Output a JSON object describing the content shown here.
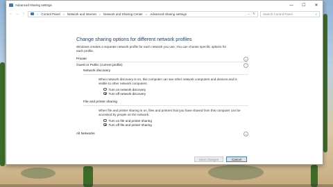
{
  "window": {
    "title": "Advanced sharing settings",
    "controls": {
      "minimize": "—",
      "maximize": "☐",
      "close": "✕"
    }
  },
  "address": {
    "back": "←",
    "forward": "→",
    "up": "↑",
    "crumbs": [
      "Control Panel",
      "Network and Internet",
      "Network and Sharing Center",
      "Advanced sharing settings"
    ],
    "separator": ">",
    "dropdown": "⌄",
    "refresh": "↻",
    "search_placeholder": "Search Control Panel",
    "search_icon": "⌕"
  },
  "main": {
    "heading": "Change sharing options for different network profiles",
    "description": "Windows creates a separate network profile for each network you use. You can choose specific options for each profile.",
    "private_label": "Private",
    "guest_label": "Guest or Public (current profile)",
    "all_networks_label": "All Networks",
    "chevron_collapsed": "⌄",
    "chevron_expanded": "⌃",
    "network_discovery": {
      "title": "Network discovery",
      "description": "When network discovery is on, this computer can see other network computers and devices and is visible to other network computers.",
      "options": [
        {
          "label": "Turn on network discovery",
          "checked": false
        },
        {
          "label": "Turn off network discovery",
          "checked": true
        }
      ]
    },
    "file_printer_sharing": {
      "title": "File and printer sharing",
      "description": "When file and printer sharing is on, files and printers that you have shared from this computer can be accessed by people on the network.",
      "options": [
        {
          "label": "Turn on file and printer sharing",
          "checked": false
        },
        {
          "label": "Turn off file and printer sharing",
          "checked": true
        }
      ]
    }
  },
  "footer": {
    "save_label": "Save changes",
    "cancel_label": "Cancel"
  }
}
